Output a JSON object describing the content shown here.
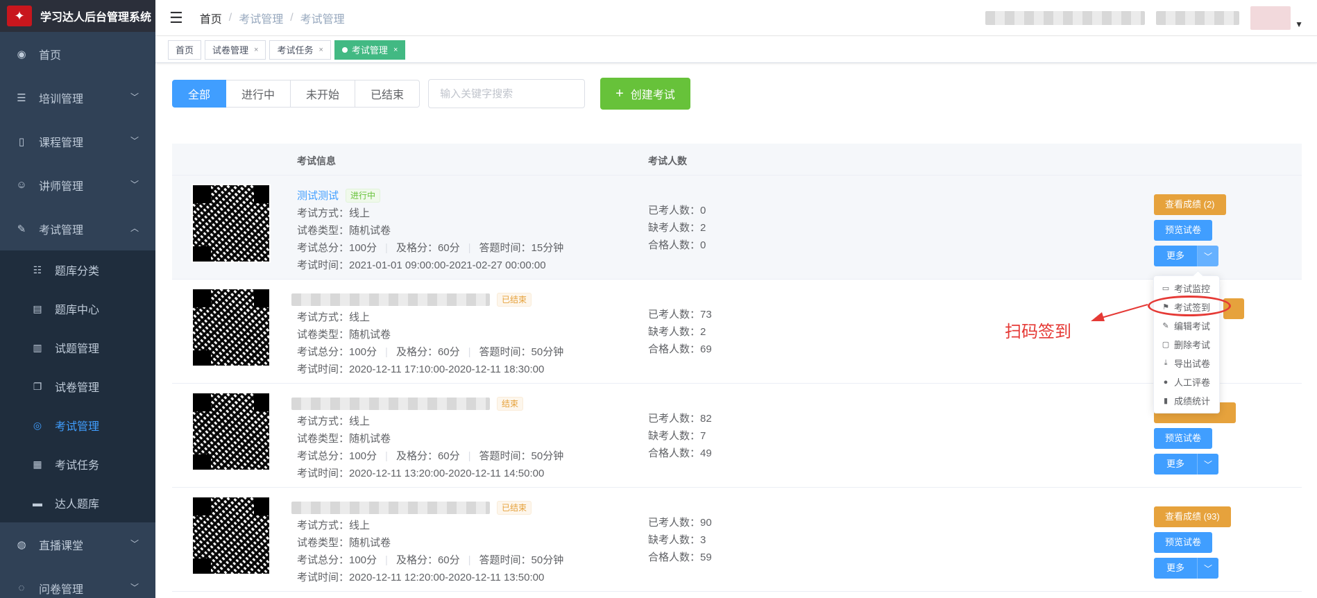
{
  "app": {
    "title": "学习达人后台管理系统"
  },
  "sidebar": {
    "items": [
      {
        "label": "首页",
        "icon": "dashboard-icon",
        "has_children": false
      },
      {
        "label": "培训管理",
        "icon": "list-tree-icon",
        "has_children": true
      },
      {
        "label": "课程管理",
        "icon": "book-icon",
        "has_children": true
      },
      {
        "label": "讲师管理",
        "icon": "teacher-icon",
        "has_children": true
      },
      {
        "label": "考试管理",
        "icon": "edit-icon",
        "has_children": true,
        "expanded": true
      }
    ],
    "submenu": [
      {
        "label": "题库分类",
        "icon": "list-icon"
      },
      {
        "label": "题库中心",
        "icon": "document-icon"
      },
      {
        "label": "试题管理",
        "icon": "book-open-icon"
      },
      {
        "label": "试卷管理",
        "icon": "copy-icon"
      },
      {
        "label": "考试管理",
        "icon": "target-icon",
        "active": true
      },
      {
        "label": "考试任务",
        "icon": "table-icon"
      },
      {
        "label": "达人题库",
        "icon": "folder-icon"
      }
    ],
    "items_after": [
      {
        "label": "直播课堂",
        "icon": "eye-icon"
      },
      {
        "label": "问卷管理",
        "icon": "chat-icon"
      }
    ]
  },
  "breadcrumb": [
    "首页",
    "考试管理",
    "考试管理"
  ],
  "tags": [
    {
      "label": "首页",
      "closable": false,
      "active": false
    },
    {
      "label": "试卷管理",
      "closable": true,
      "active": false
    },
    {
      "label": "考试任务",
      "closable": true,
      "active": false
    },
    {
      "label": "考试管理",
      "closable": true,
      "active": true
    }
  ],
  "filters": {
    "tabs": [
      "全部",
      "进行中",
      "未开始",
      "已结束"
    ],
    "active_tab": "全部",
    "search_placeholder": "输入关键字搜索",
    "search_value": "",
    "create_label": "创建考试"
  },
  "table": {
    "headers": {
      "info": "考试信息",
      "count": "考试人数"
    },
    "rows": [
      {
        "title": "测试测试",
        "title_visible": true,
        "status": "进行中",
        "status_color": "green",
        "method": "考试方式：线上",
        "paper_type": "试卷类型：随机试卷",
        "total_score": "考试总分：100分",
        "pass_score": "及格分：60分",
        "answer_time": "答题时间：15分钟",
        "exam_time": "考试时间：2021-01-01 09:00:00-2021-02-27 00:00:00",
        "taken": "已考人数：0",
        "absent": "缺考人数：2",
        "passed": "合格人数：0",
        "score_btn": "查看成绩 (2)"
      },
      {
        "title": "",
        "title_visible": false,
        "status": "已结束",
        "status_color": "orange",
        "method": "考试方式：线上",
        "paper_type": "试卷类型：随机试卷",
        "total_score": "考试总分：100分",
        "pass_score": "及格分：60分",
        "answer_time": "答题时间：50分钟",
        "exam_time": "考试时间：2020-12-11 17:10:00-2020-12-11 18:30:00",
        "taken": "已考人数：73",
        "absent": "缺考人数：2",
        "passed": "合格人数：69",
        "score_btn": ""
      },
      {
        "title": "",
        "title_visible": false,
        "status": "结束",
        "status_color": "orange",
        "method": "考试方式：线上",
        "paper_type": "试卷类型：随机试卷",
        "total_score": "考试总分：100分",
        "pass_score": "及格分：60分",
        "answer_time": "答题时间：50分钟",
        "exam_time": "考试时间：2020-12-11 13:20:00-2020-12-11 14:50:00",
        "taken": "已考人数：82",
        "absent": "缺考人数：7",
        "passed": "合格人数：49",
        "score_btn": ""
      },
      {
        "title": "",
        "title_visible": false,
        "status": "已结束",
        "status_color": "orange",
        "method": "考试方式：线上",
        "paper_type": "试卷类型：随机试卷",
        "total_score": "考试总分：100分",
        "pass_score": "及格分：60分",
        "answer_time": "答题时间：50分钟",
        "exam_time": "考试时间：2020-12-11 12:20:00-2020-12-11 13:50:00",
        "taken": "已考人数：90",
        "absent": "缺考人数：3",
        "passed": "合格人数：59",
        "score_btn": "查看成绩 (93)"
      }
    ],
    "preview_btn": "预览试卷",
    "more_btn": "更多"
  },
  "dropdown": {
    "items": [
      {
        "label": "考试监控",
        "icon": "monitor-icon"
      },
      {
        "label": "考试签到",
        "icon": "flag-icon"
      },
      {
        "label": "编辑考试",
        "icon": "pencil-icon"
      },
      {
        "label": "删除考试",
        "icon": "trash-icon"
      },
      {
        "label": "导出试卷",
        "icon": "download-icon"
      },
      {
        "label": "人工评卷",
        "icon": "user-icon"
      },
      {
        "label": "成绩统计",
        "icon": "bar-chart-icon"
      }
    ]
  },
  "annotation": {
    "text": "扫码签到"
  },
  "colors": {
    "primary": "#409eff",
    "success": "#67c23a",
    "warning": "#e6a23c",
    "sidebar": "#304156",
    "annotation": "#e53935"
  }
}
